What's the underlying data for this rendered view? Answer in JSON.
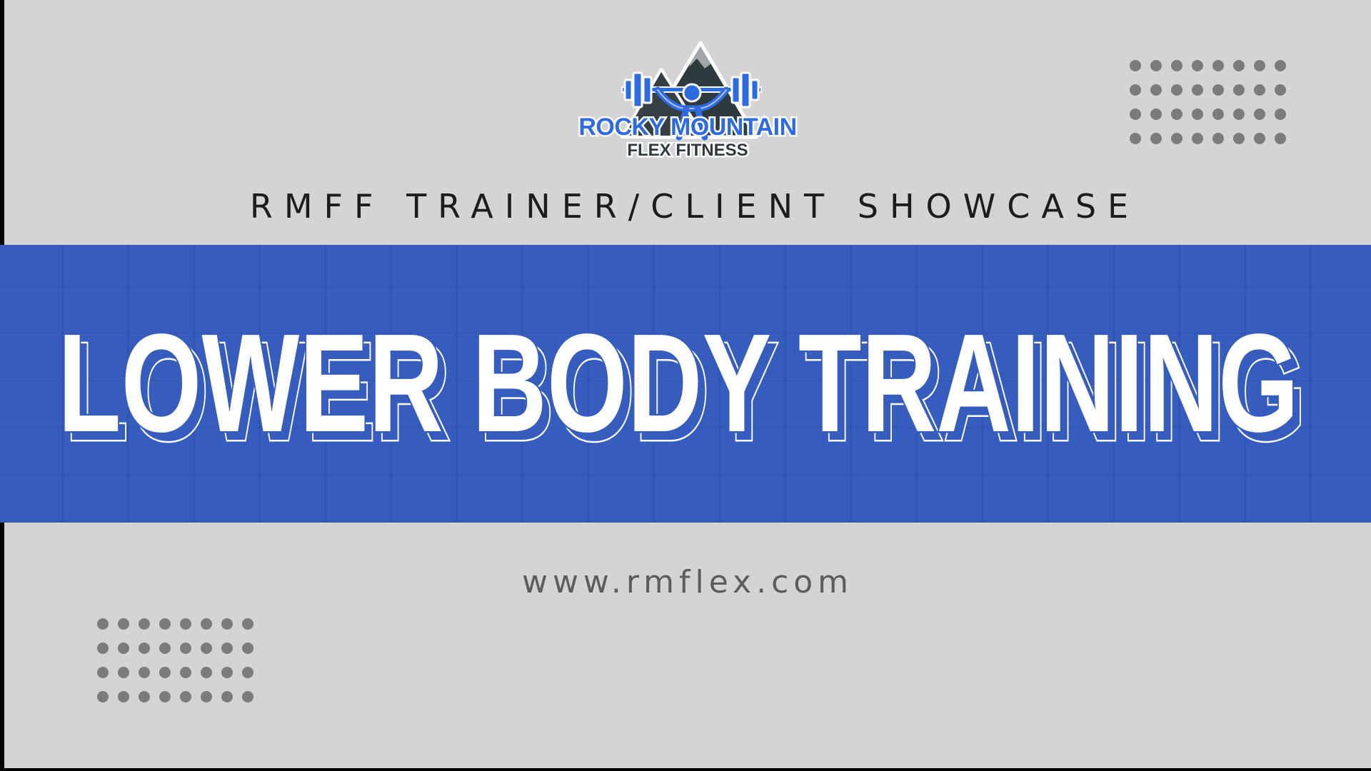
{
  "brand": {
    "logo_line1": "ROCKY MOUNTAIN",
    "logo_line2": "FLEX FITNESS",
    "accent_color": "#365dbd",
    "logo_blue": "#2f6be0"
  },
  "subtitle": "RMFF TRAINER/CLIENT SHOWCASE",
  "headline": "LOWER BODY TRAINING",
  "website": "www.rmflex.com",
  "decor": {
    "top_dot_grid": {
      "rows": 4,
      "cols": 8
    },
    "bottom_dot_grid": {
      "rows": 4,
      "cols": 8
    }
  }
}
